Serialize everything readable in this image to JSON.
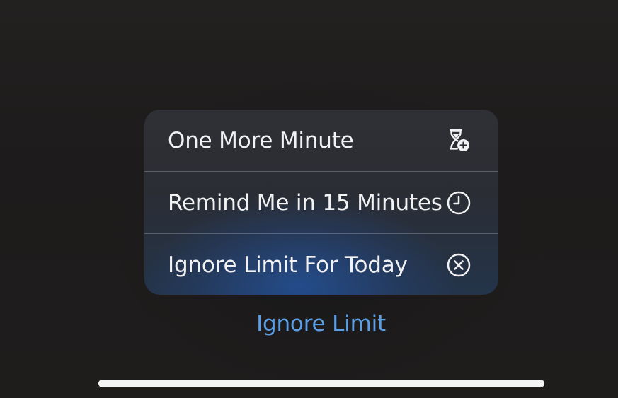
{
  "menu": {
    "items": [
      {
        "label": "One More Minute",
        "icon": "hourglass-plus-icon"
      },
      {
        "label": "Remind Me in 15 Minutes",
        "icon": "clock-icon"
      },
      {
        "label": "Ignore Limit For Today",
        "icon": "x-circle-icon"
      }
    ]
  },
  "action": {
    "label": "Ignore Limit"
  },
  "colors": {
    "accent": "#5a9fe6",
    "menu_text": "#f2f2f4",
    "background": "#1e1c1c"
  }
}
